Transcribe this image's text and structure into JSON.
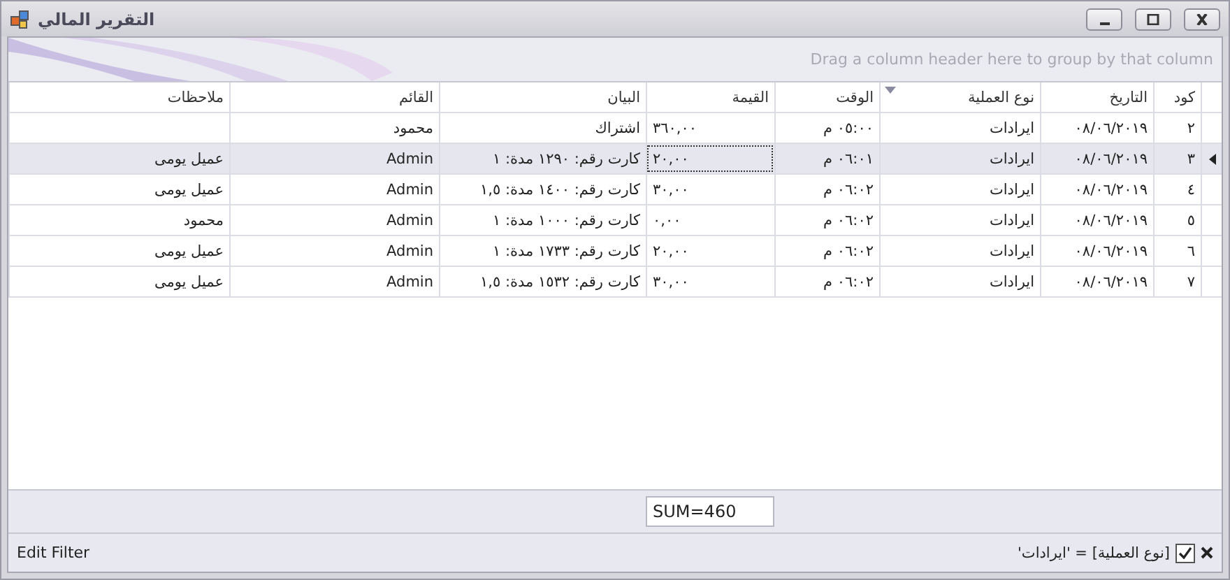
{
  "window": {
    "title": "التقرير المالي"
  },
  "group_panel": {
    "hint": "Drag a column header here to group by that column"
  },
  "table": {
    "columns": [
      {
        "label": "كود",
        "filtered": false,
        "has_focus": false,
        "kind": "text"
      },
      {
        "label": "التاريخ",
        "filtered": false,
        "has_focus": false,
        "kind": "text"
      },
      {
        "label": "نوع العملية",
        "filtered": true,
        "has_focus": false,
        "kind": "text"
      },
      {
        "label": "الوقت",
        "filtered": false,
        "has_focus": false,
        "kind": "time"
      },
      {
        "label": "القيمة",
        "filtered": false,
        "has_focus": true,
        "kind": "number",
        "summary": "SUM=460"
      },
      {
        "label": "البيان",
        "filtered": false,
        "has_focus": false,
        "kind": "text"
      },
      {
        "label": "القائم",
        "filtered": false,
        "has_focus": false,
        "kind": "text"
      },
      {
        "label": "ملاحظات",
        "filtered": false,
        "has_focus": false,
        "kind": "text"
      }
    ],
    "rows": [
      {
        "selected": false,
        "cells": [
          "٢",
          "٠٨/٠٦/٢٠١٩",
          "ايرادات",
          "٠٥:٠٠ م",
          "٣٦٠,٠٠",
          "اشتراك",
          "محمود",
          ""
        ]
      },
      {
        "selected": true,
        "cells": [
          "٣",
          "٠٨/٠٦/٢٠١٩",
          "ايرادات",
          "٠٦:٠١ م",
          "٢٠,٠٠",
          "كارت رقم: ١٢٩٠ مدة: ١",
          "Admin",
          "عميل يومى"
        ]
      },
      {
        "selected": false,
        "cells": [
          "٤",
          "٠٨/٠٦/٢٠١٩",
          "ايرادات",
          "٠٦:٠٢ م",
          "٣٠,٠٠",
          "كارت رقم: ١٤٠٠ مدة: ١,٥",
          "Admin",
          "عميل يومى"
        ]
      },
      {
        "selected": false,
        "cells": [
          "٥",
          "٠٨/٠٦/٢٠١٩",
          "ايرادات",
          "٠٦:٠٢ م",
          "٠,٠٠",
          "كارت رقم: ١٠٠٠ مدة: ١",
          "Admin",
          "محمود"
        ]
      },
      {
        "selected": false,
        "cells": [
          "٦",
          "٠٨/٠٦/٢٠١٩",
          "ايرادات",
          "٠٦:٠٢ م",
          "٢٠,٠٠",
          "كارت رقم: ١٧٣٣ مدة: ١",
          "Admin",
          "عميل يومى"
        ]
      },
      {
        "selected": false,
        "cells": [
          "٧",
          "٠٨/٠٦/٢٠١٩",
          "ايرادات",
          "٠٦:٠٢ م",
          "٣٠,٠٠",
          "كارت رقم: ١٥٣٢ مدة: ١,٥",
          "Admin",
          "عميل يومى"
        ]
      }
    ]
  },
  "filter_bar": {
    "enabled": true,
    "expression": "[نوع العملية] = 'ايرادات'",
    "edit_label": "Edit Filter"
  }
}
